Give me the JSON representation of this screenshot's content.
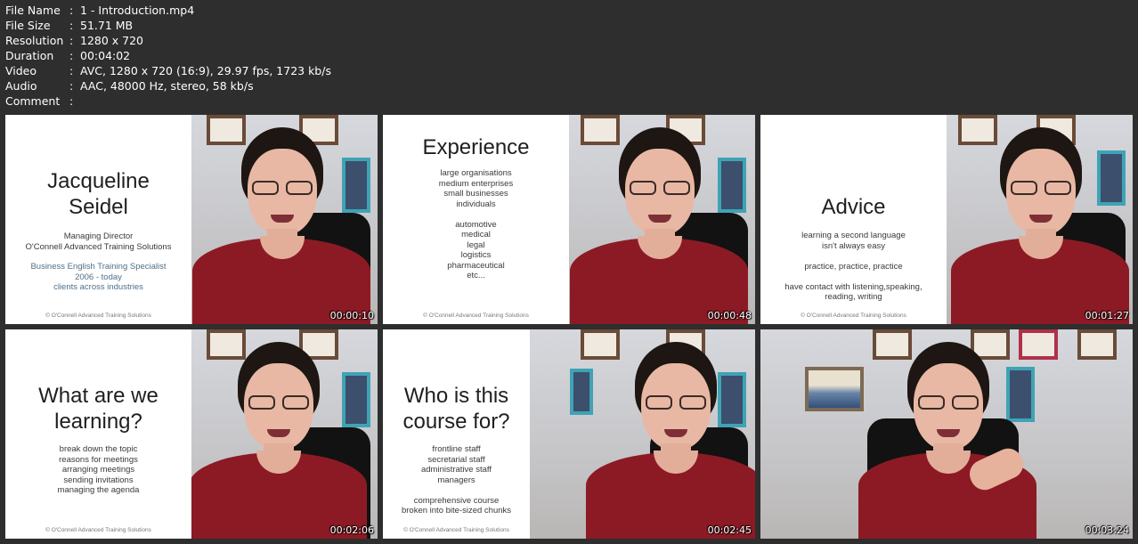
{
  "metadata": [
    {
      "key": "File Name",
      "value": "1 - Introduction.mp4"
    },
    {
      "key": "File Size",
      "value": "51.71 MB"
    },
    {
      "key": "Resolution",
      "value": "1280 x 720"
    },
    {
      "key": "Duration",
      "value": "00:04:02"
    },
    {
      "key": "Video",
      "value": "AVC, 1280 x 720 (16:9), 29.97 fps, 1723 kb/s"
    },
    {
      "key": "Audio",
      "value": "AAC, 48000 Hz, stereo, 58 kb/s"
    },
    {
      "key": "Comment",
      "value": ""
    }
  ],
  "separator": ":",
  "thumbnails": [
    {
      "timestamp": "00:00:10",
      "slide": {
        "title_lines": [
          "Jacqueline",
          "Seidel"
        ],
        "body": [
          "Managing Director",
          "O'Connell Advanced Training Solutions"
        ],
        "body_blue": [
          "Business English Training Specialist",
          "2006 - today",
          "clients across industries"
        ],
        "footer": "© O'Connell Advanced Training Solutions"
      }
    },
    {
      "timestamp": "00:00:48",
      "slide": {
        "title_lines": [
          "Experience"
        ],
        "body": [
          "large organisations",
          "medium enterprises",
          "small businesses",
          "individuals",
          "",
          "automotive",
          "medical",
          "legal",
          "logistics",
          "pharmaceutical",
          "etc..."
        ],
        "footer": "© O'Connell Advanced Training Solutions"
      }
    },
    {
      "timestamp": "00:01:27",
      "slide": {
        "title_lines": [
          "Advice"
        ],
        "body": [
          "learning a second language",
          "isn't always easy",
          "",
          "practice, practice, practice",
          "",
          "have contact with listening,speaking,",
          "reading, writing"
        ],
        "footer": "© O'Connell Advanced Training Solutions"
      }
    },
    {
      "timestamp": "00:02:06",
      "slide": {
        "title_lines": [
          "What are we",
          "learning?"
        ],
        "body": [
          "break down the topic",
          "reasons for meetings",
          "arranging meetings",
          "sending invitations",
          "managing the agenda"
        ],
        "footer": "© O'Connell Advanced Training Solutions"
      }
    },
    {
      "timestamp": "00:02:45",
      "slide": {
        "title_lines": [
          "Who is this",
          "course for?"
        ],
        "body": [
          "frontline staff",
          "secretarial staff",
          "administrative staff",
          "managers",
          "",
          "comprehensive course",
          "broken into bite-sized chunks"
        ],
        "footer": "© O'Connell Advanced Training Solutions"
      }
    },
    {
      "timestamp": "00:03:24",
      "slide": null
    }
  ]
}
